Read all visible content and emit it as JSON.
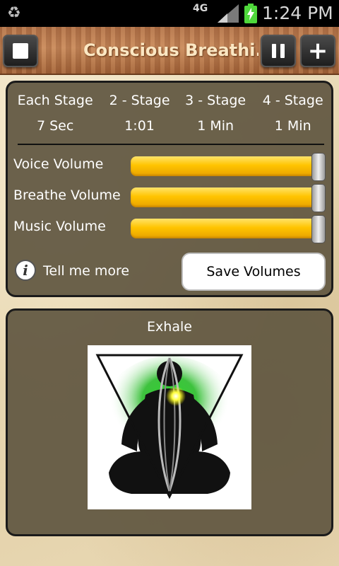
{
  "status_bar": {
    "network": "4G",
    "clock": "1:24 PM"
  },
  "header": {
    "title": "Conscious Breathi..."
  },
  "stages": {
    "headers": [
      "Each Stage",
      "2 - Stage",
      "3 - Stage",
      "4 - Stage"
    ],
    "values": [
      "7 Sec",
      "1:01",
      "1 Min",
      "1 Min"
    ]
  },
  "volumes": [
    {
      "label": "Voice Volume",
      "level": 1.0
    },
    {
      "label": "Breathe Volume",
      "level": 1.0
    },
    {
      "label": "Music Volume",
      "level": 1.0
    }
  ],
  "info": {
    "icon": "info-icon",
    "label": "Tell me more"
  },
  "save_button": {
    "label": "Save Volumes"
  },
  "breath_panel": {
    "phase": "Exhale"
  },
  "colors": {
    "slider_fill": "#ffc400",
    "panel_bg": "#605640",
    "title_text": "#fbe7c3"
  }
}
